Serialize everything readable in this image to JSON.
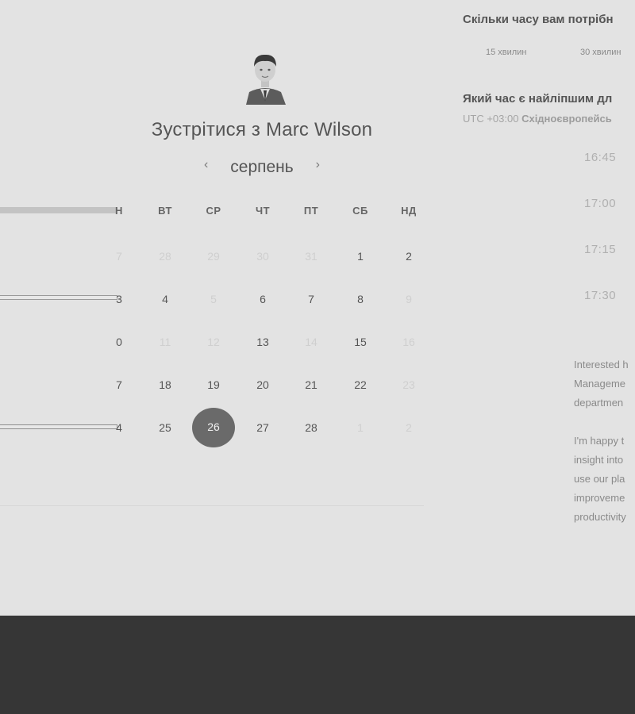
{
  "host": {
    "title": "Зустрітися з Marc Wilson",
    "avatar_icon": "person-photo"
  },
  "calendar": {
    "month": "серпень",
    "prev_icon": "chevron-left-icon",
    "next_icon": "chevron-right-icon",
    "weekdays": [
      "Н",
      "ВТ",
      "СР",
      "ЧТ",
      "ПТ",
      "СБ",
      "НД"
    ],
    "weeks": [
      [
        {
          "t": "7",
          "s": "faded"
        },
        {
          "t": "28",
          "s": "faded"
        },
        {
          "t": "29",
          "s": "faded"
        },
        {
          "t": "30",
          "s": "faded"
        },
        {
          "t": "31",
          "s": "faded"
        },
        {
          "t": "1",
          "s": "avail"
        },
        {
          "t": "2",
          "s": "avail"
        }
      ],
      [
        {
          "t": "3",
          "s": "avail"
        },
        {
          "t": "4",
          "s": "avail"
        },
        {
          "t": "5",
          "s": "faded"
        },
        {
          "t": "6",
          "s": "avail"
        },
        {
          "t": "7",
          "s": "avail"
        },
        {
          "t": "8",
          "s": "avail"
        },
        {
          "t": "9",
          "s": "faded"
        }
      ],
      [
        {
          "t": "0",
          "s": "avail"
        },
        {
          "t": "11",
          "s": "faded"
        },
        {
          "t": "12",
          "s": "faded"
        },
        {
          "t": "13",
          "s": "avail"
        },
        {
          "t": "14",
          "s": "faded"
        },
        {
          "t": "15",
          "s": "avail"
        },
        {
          "t": "16",
          "s": "faded"
        }
      ],
      [
        {
          "t": "7",
          "s": "avail"
        },
        {
          "t": "18",
          "s": "avail"
        },
        {
          "t": "19",
          "s": "avail"
        },
        {
          "t": "20",
          "s": "avail"
        },
        {
          "t": "21",
          "s": "avail"
        },
        {
          "t": "22",
          "s": "avail"
        },
        {
          "t": "23",
          "s": "faded"
        }
      ],
      [
        {
          "t": "4",
          "s": "avail"
        },
        {
          "t": "25",
          "s": "avail"
        },
        {
          "t": "26",
          "s": "selected"
        },
        {
          "t": "27",
          "s": "avail"
        },
        {
          "t": "28",
          "s": "avail"
        },
        {
          "t": "1",
          "s": "faded"
        },
        {
          "t": "2",
          "s": "faded"
        }
      ]
    ],
    "selected_day": "26"
  },
  "booking": {
    "duration_question": "Скільки часу вам потрібн",
    "durations": [
      "15 хвилин",
      "30 хвилин"
    ],
    "time_question": "Який час є найліпшим дл",
    "timezone_prefix": "UTC +03:00 ",
    "timezone_name": "Східноєвропейсь",
    "slots": [
      "16:45",
      "17:00",
      "17:15",
      "17:30"
    ]
  },
  "description": {
    "lines": [
      "Interested h",
      "Manageme",
      "departmen",
      "",
      "I'm happy t",
      "insight into",
      "use our pla",
      "improveme",
      "productivity"
    ]
  },
  "colors": {
    "background": "#e3e3e3",
    "footer": "#363636",
    "selected_day": "#6a6a6a"
  }
}
